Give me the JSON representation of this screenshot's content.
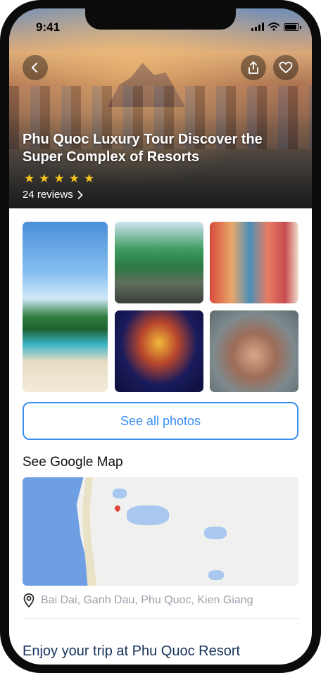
{
  "status_bar": {
    "time": "9:41"
  },
  "hero": {
    "title": "Phu Quoc Luxury Tour Discover the Super Complex of Resorts",
    "rating": 5,
    "reviews_label": "24 reviews"
  },
  "icons": {
    "back": "back-chevron-icon",
    "share": "share-icon",
    "favorite": "heart-icon"
  },
  "photos": [
    "beach",
    "vinpearl-safari",
    "colorful-buildings",
    "light-show",
    "castle-complex"
  ],
  "actions": {
    "see_all_photos": "See all photos"
  },
  "map_section": {
    "title": "See Google Map",
    "address": "Bai Dai, Ganh Dau, Phu Quoc, Kien Giang"
  },
  "footer_section": {
    "title": "Enjoy your trip at Phu Quoc Resort"
  },
  "colors": {
    "accent": "#3a8ef0",
    "star": "#f6c21c",
    "heading_dark": "#17325a"
  }
}
